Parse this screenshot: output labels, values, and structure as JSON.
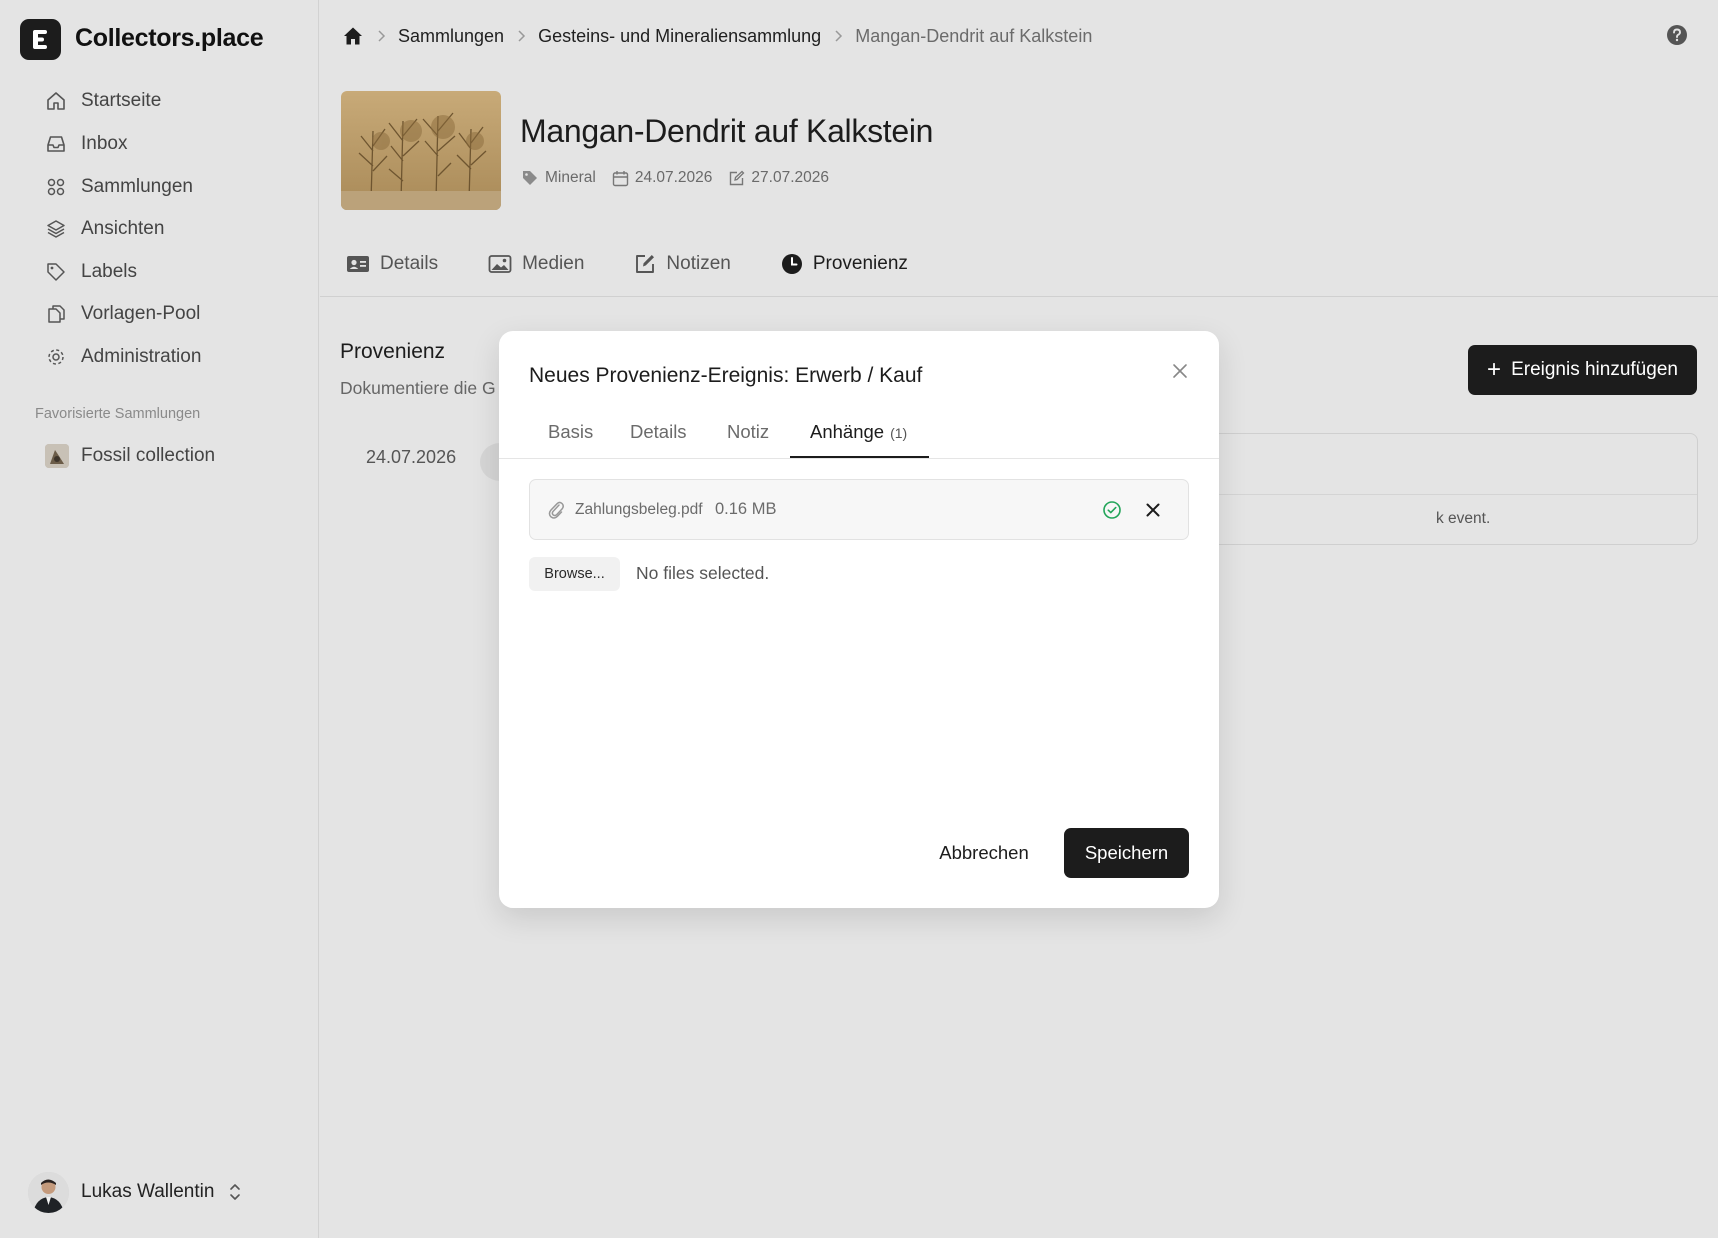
{
  "app": {
    "name": "Collectors.place"
  },
  "sidebar": {
    "items": [
      {
        "label": "Startseite",
        "icon": "home-icon"
      },
      {
        "label": "Inbox",
        "icon": "inbox-icon"
      },
      {
        "label": "Sammlungen",
        "icon": "grid-icon"
      },
      {
        "label": "Ansichten",
        "icon": "layers-icon"
      },
      {
        "label": "Labels",
        "icon": "tag-icon"
      },
      {
        "label": "Vorlagen-Pool",
        "icon": "copy-icon"
      },
      {
        "label": "Administration",
        "icon": "gear-icon"
      }
    ],
    "favorites_heading": "Favorisierte Sammlungen",
    "favorites": [
      {
        "label": "Fossil collection"
      }
    ],
    "user": {
      "name": "Lukas Wallentin"
    }
  },
  "breadcrumb": {
    "items": [
      "Sammlungen",
      "Gesteins- und Mineraliensammlung",
      "Mangan-Dendrit auf Kalkstein"
    ]
  },
  "item": {
    "title": "Mangan-Dendrit auf Kalkstein",
    "category": "Mineral",
    "created": "24.07.2026",
    "modified": "27.07.2026"
  },
  "tabs": [
    {
      "label": "Details",
      "icon": "id-card-icon"
    },
    {
      "label": "Medien",
      "icon": "image-icon"
    },
    {
      "label": "Notizen",
      "icon": "edit-icon"
    },
    {
      "label": "Provenienz",
      "icon": "clock-icon",
      "active": true
    }
  ],
  "provenance": {
    "title": "Provenienz",
    "description": "Dokumentiere die G",
    "add_button": "Ereignis hinzufügen",
    "timeline_date": "24.07.2026",
    "card_text": "k event."
  },
  "modal": {
    "title": "Neues Provenienz-Ereignis: Erwerb / Kauf",
    "tabs": [
      {
        "label": "Basis"
      },
      {
        "label": "Details"
      },
      {
        "label": "Notiz"
      },
      {
        "label": "Anhänge",
        "count": "(1)",
        "active": true
      }
    ],
    "attachment": {
      "name": "Zahlungsbeleg.pdf",
      "size": "0.16 MB"
    },
    "browse_label": "Browse...",
    "no_files": "No files selected.",
    "cancel": "Abbrechen",
    "save": "Speichern"
  },
  "colors": {
    "background": "#e4e4e4",
    "primary": "#1c1c1c",
    "success": "#22a559",
    "modal": "#ffffff"
  }
}
